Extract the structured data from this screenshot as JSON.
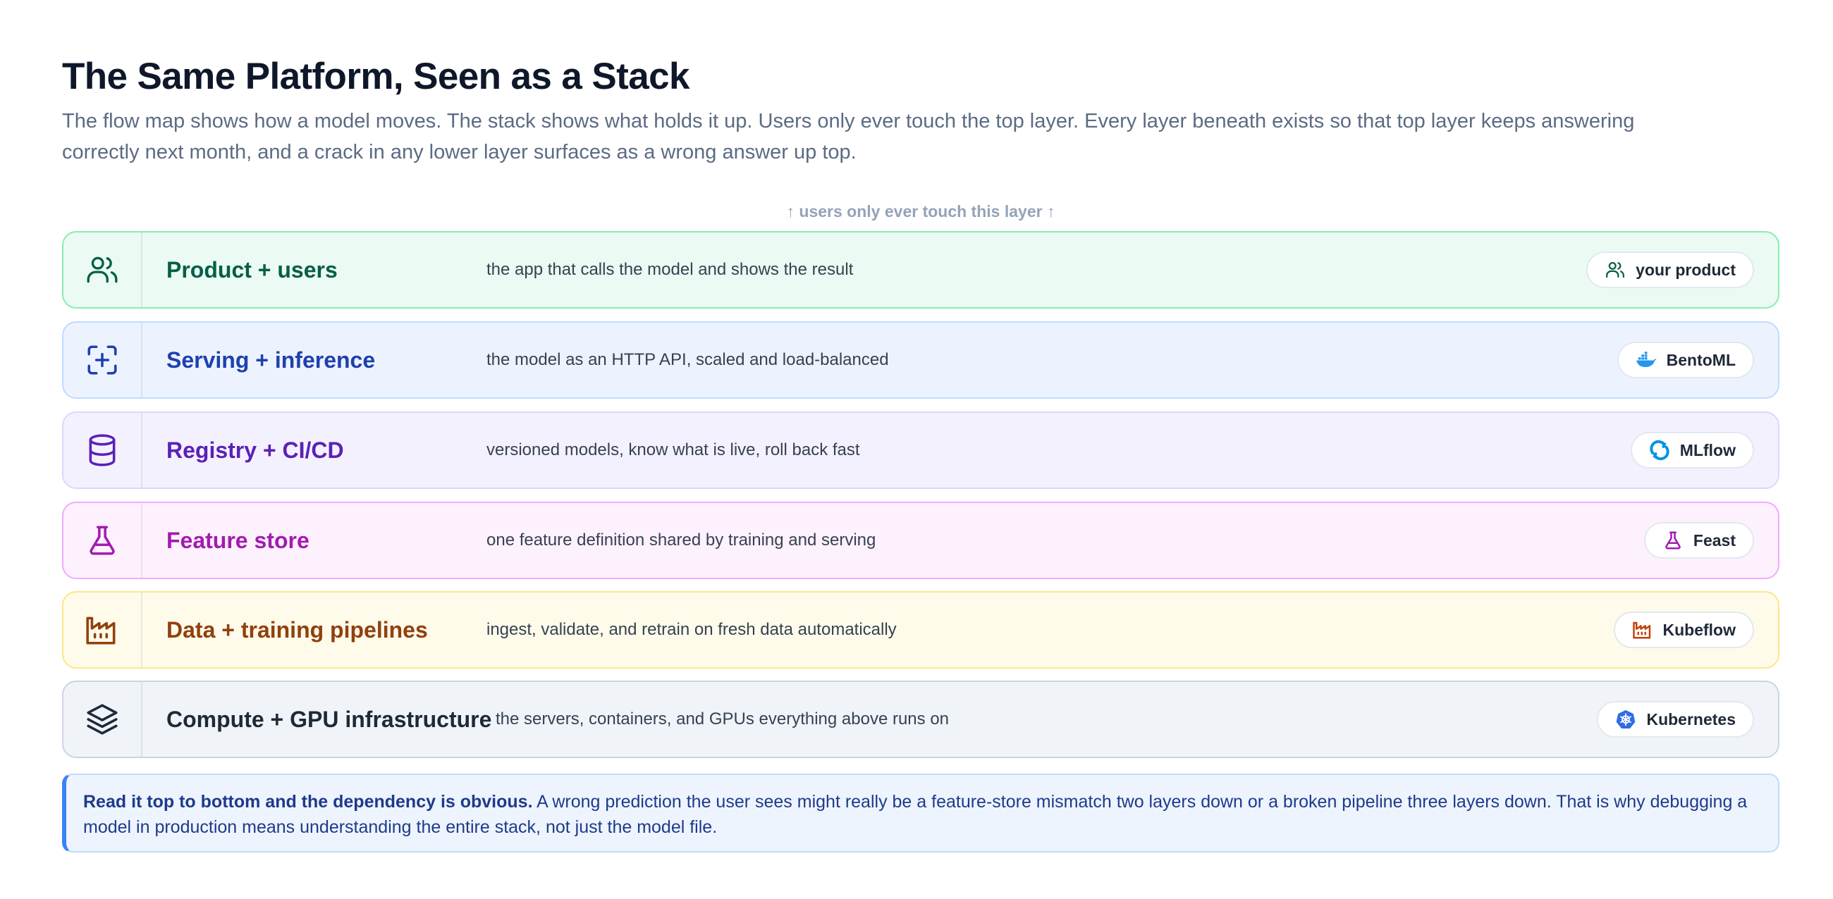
{
  "header": {
    "title": "The Same Platform, Seen as a Stack",
    "subtitle": "The flow map shows how a model moves. The stack shows what holds it up. Users only ever touch the top layer. Every layer beneath exists so that top layer keeps answering correctly next month, and a crack in any lower layer surfaces as a wrong answer up top."
  },
  "top_note": "↑ users only ever touch this layer ↑",
  "layers": [
    {
      "name": "Product + users",
      "description": "the app that calls the model and shows the result",
      "tool": "your product",
      "icon": "users-icon",
      "tool_icon": "users-icon",
      "accent": "#065f46"
    },
    {
      "name": "Serving + inference",
      "description": "the model as an HTTP API, scaled and load-balanced",
      "tool": "BentoML",
      "icon": "focus-plus-icon",
      "tool_icon": "docker-whale-icon",
      "accent": "#1e40af"
    },
    {
      "name": "Registry + CI/CD",
      "description": "versioned models, know what is live, roll back fast",
      "tool": "MLflow",
      "icon": "database-icon",
      "tool_icon": "mlflow-icon",
      "accent": "#5b21b6"
    },
    {
      "name": "Feature store",
      "description": "one feature definition shared by training and serving",
      "tool": "Feast",
      "icon": "flask-icon",
      "tool_icon": "flask-icon",
      "accent": "#a21caf"
    },
    {
      "name": "Data + training pipelines",
      "description": "ingest, validate, and retrain on fresh data automatically",
      "tool": "Kubeflow",
      "icon": "factory-icon",
      "tool_icon": "factory-icon",
      "accent": "#92400e"
    },
    {
      "name": "Compute + GPU infrastructure",
      "description": "the servers, containers, and GPUs everything above runs on",
      "tool": "Kubernetes",
      "icon": "layers-icon",
      "tool_icon": "kubernetes-icon",
      "accent": "#1f2937"
    }
  ],
  "callout": {
    "bold": "Read it top to bottom and the dependency is obvious.",
    "text": " A wrong prediction the user sees might really be a feature-store mismatch two layers down or a broken pipeline three layers down. That is why debugging a model in production means understanding the entire stack, not just the model file."
  }
}
